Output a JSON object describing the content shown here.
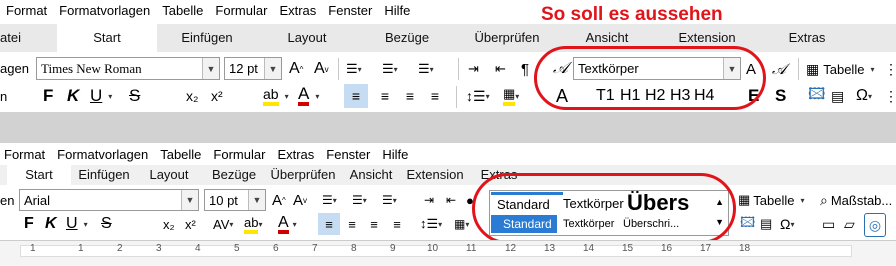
{
  "annotation": {
    "text": "So soll es aussehen",
    "color": "#e1141a"
  },
  "top": {
    "menu": [
      "Format",
      "Formatvorlagen",
      "Tabelle",
      "Formular",
      "Extras",
      "Fenster",
      "Hilfe"
    ],
    "tabs": [
      "atei",
      "Start",
      "Einfügen",
      "Layout",
      "Bezüge",
      "Überprüfen",
      "Ansicht",
      "Extension",
      "Extras"
    ],
    "active_tab": "Start",
    "row1": {
      "style_label_fragment": "agen",
      "font_name": "Times New Roman",
      "font_size": "12 pt",
      "style_box": "Textkörper",
      "table_label": "Tabelle"
    },
    "row2": {
      "fragment": "n",
      "bold": "F",
      "italic": "K",
      "underline": "U",
      "strike": "S",
      "subscript": "x₂",
      "superscript": "x²",
      "font_color_letter": "A",
      "style_A": "A",
      "headings": [
        "T1",
        "H1",
        "H2",
        "H3",
        "H4"
      ],
      "bold2": "S"
    }
  },
  "bottom": {
    "menu": [
      "Format",
      "Formatvorlagen",
      "Tabelle",
      "Formular",
      "Extras",
      "Fenster",
      "Hilfe"
    ],
    "tabs": [
      "Start",
      "Einfügen",
      "Layout",
      "Bezüge",
      "Überprüfen",
      "Ansicht",
      "Extension",
      "Extras"
    ],
    "active_tab": "Start",
    "row1": {
      "fragment": "en",
      "font_name": "Arial",
      "font_size": "10 pt",
      "table_label": "Tabelle",
      "measure_label": "Maßstab..."
    },
    "row2": {
      "bold": "F",
      "italic": "K",
      "underline": "U",
      "strike": "S",
      "subscript": "x₂",
      "superscript": "x²",
      "spacing": "AV",
      "font_color_letter": "A"
    },
    "style_preview": {
      "big": [
        "Standard",
        "Textkörper",
        "Übers"
      ],
      "small": [
        "Standard",
        "Textkörper",
        "Überschri..."
      ]
    },
    "ruler_numbers": [
      "1",
      "1",
      "2",
      "3",
      "4",
      "5",
      "6",
      "7",
      "8",
      "9",
      "10",
      "11",
      "12",
      "13",
      "14",
      "15",
      "16",
      "17",
      "18"
    ]
  }
}
